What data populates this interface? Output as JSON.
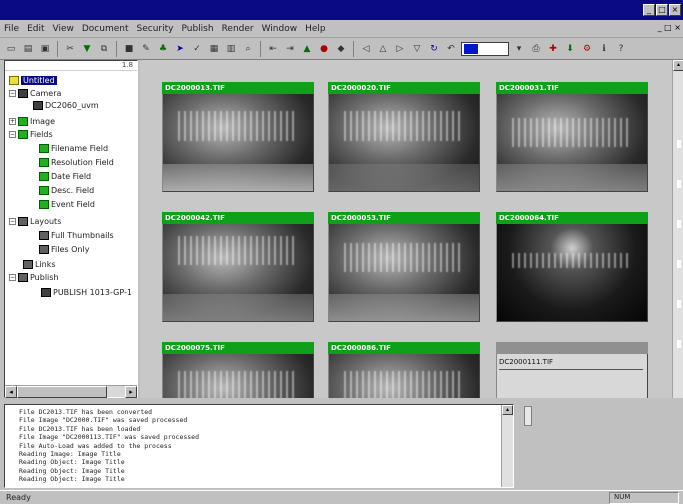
{
  "window": {
    "controls": [
      "_",
      "□",
      "×"
    ]
  },
  "menubar": {
    "items": [
      "File",
      "Edit",
      "View",
      "Document",
      "Security",
      "Publish",
      "Render",
      "Window",
      "Help"
    ],
    "right": "_ □ ×"
  },
  "toolbar": {
    "color_accent": "#0018c8"
  },
  "tree": {
    "header": "1.8",
    "nodes": [
      {
        "label": "Untitled",
        "icon": "folder-icon",
        "selected": true
      },
      {
        "label": "Camera",
        "icon": "camera-icon"
      },
      {
        "label": "DC2060_uvm",
        "icon": "camera-icon"
      },
      {
        "label": "Image",
        "icon": "image-icon"
      },
      {
        "label": "Fields",
        "icon": "fields-icon"
      },
      {
        "label": "Filename Field",
        "icon": "field-icon"
      },
      {
        "label": "Resolution Field",
        "icon": "field-icon"
      },
      {
        "label": "Date Field",
        "icon": "field-icon"
      },
      {
        "label": "Desc. Field",
        "icon": "field-icon"
      },
      {
        "label": "Event Field",
        "icon": "field-icon"
      },
      {
        "label": "Layouts",
        "icon": "layout-icon"
      },
      {
        "label": "Full Thumbnails",
        "icon": "layout-icon"
      },
      {
        "label": "Files Only",
        "icon": "layout-icon"
      },
      {
        "label": "Links",
        "icon": "link-icon"
      },
      {
        "label": "Publish",
        "icon": "network-icon"
      },
      {
        "label": "PUBLISH 1013-GP-1",
        "icon": "server-icon"
      }
    ]
  },
  "thumbnails": [
    {
      "caption": "DC2000013.TIF"
    },
    {
      "caption": "DC2000020.TIF"
    },
    {
      "caption": "DC2000031.TIF"
    },
    {
      "caption": "DC2000042.TIF"
    },
    {
      "caption": "DC2000053.TIF"
    },
    {
      "caption": "DC2000064.TIF"
    },
    {
      "caption": "DC2000075.TIF"
    },
    {
      "caption": "DC2000086.TIF"
    },
    {
      "caption": "",
      "pending": true,
      "filename": "DC2000111.TIF"
    }
  ],
  "log": {
    "lines": [
      "File DC2013.TIF has been converted",
      "File Image \"DC2000.TIF\" was saved processed",
      "File DC2013.TIF has been loaded",
      "File Image \"DC2000113.TIF\" was saved processed",
      "File Auto-Load was added to the process",
      "Reading Image: Image Title",
      "Reading Object: Image Title",
      "Reading Object: Image Title",
      "Reading Object: Image Title"
    ]
  },
  "status": {
    "left": "Ready",
    "right": "NUM"
  }
}
